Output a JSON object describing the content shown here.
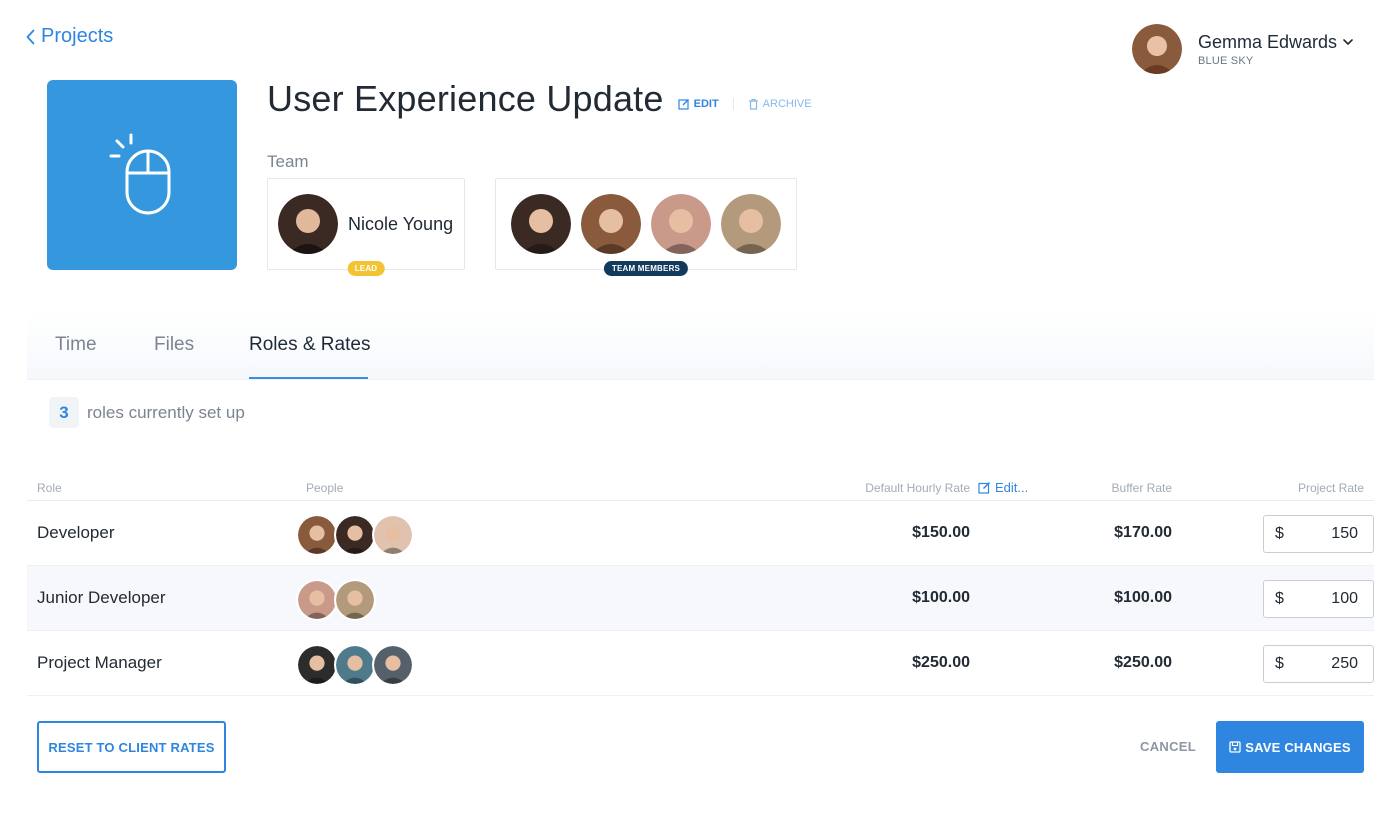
{
  "nav": {
    "back_label": "Projects"
  },
  "user": {
    "name": "Gemma Edwards",
    "org": "BLUE SKY",
    "avatar_color": "#8a5a3c"
  },
  "project": {
    "title": "User Experience Update",
    "edit_label": "EDIT",
    "archive_label": "ARCHIVE",
    "icon": "mouse-click-icon",
    "icon_bg": "#3598de"
  },
  "team": {
    "label": "Team",
    "lead": {
      "name": "Nicole Young",
      "badge": "LEAD",
      "avatar_color": "#3b2a24"
    },
    "members_badge": "TEAM MEMBERS",
    "members": [
      {
        "avatar_color": "#3b2a24"
      },
      {
        "avatar_color": "#8a5a3c"
      },
      {
        "avatar_color": "#c99a8a"
      },
      {
        "avatar_color": "#b49a7c"
      }
    ]
  },
  "tabs": [
    {
      "label": "Time",
      "active": false
    },
    {
      "label": "Files",
      "active": false
    },
    {
      "label": "Roles & Rates",
      "active": true
    }
  ],
  "summary": {
    "count": "3",
    "text": "roles currently set up"
  },
  "table": {
    "columns": {
      "role": "Role",
      "people": "People",
      "default_rate": "Default Hourly Rate",
      "edit": "Edit...",
      "buffer_rate": "Buffer Rate",
      "project_rate": "Project Rate"
    },
    "currency_symbol": "$",
    "rows": [
      {
        "role": "Developer",
        "default_rate": "$150.00",
        "buffer_rate": "$170.00",
        "project_rate": "150",
        "people": [
          {
            "avatar_color": "#8a5a3c"
          },
          {
            "avatar_color": "#3b2a24"
          },
          {
            "avatar_color": "#e0c2ae"
          }
        ]
      },
      {
        "role": "Junior Developer",
        "default_rate": "$100.00",
        "buffer_rate": "$100.00",
        "project_rate": "100",
        "people": [
          {
            "avatar_color": "#c99a8a"
          },
          {
            "avatar_color": "#b49a7c"
          }
        ]
      },
      {
        "role": "Project Manager",
        "default_rate": "$250.00",
        "buffer_rate": "$250.00",
        "project_rate": "250",
        "people": [
          {
            "avatar_color": "#2c2c2c"
          },
          {
            "avatar_color": "#4f7a8c"
          },
          {
            "avatar_color": "#56606a"
          }
        ]
      }
    ]
  },
  "actions": {
    "reset_label": "RESET TO CLIENT RATES",
    "cancel_label": "CANCEL",
    "save_label": "SAVE CHANGES"
  },
  "colors": {
    "accent": "#2f86e0",
    "lead_badge": "#f3c332",
    "members_badge": "#123a5c"
  }
}
